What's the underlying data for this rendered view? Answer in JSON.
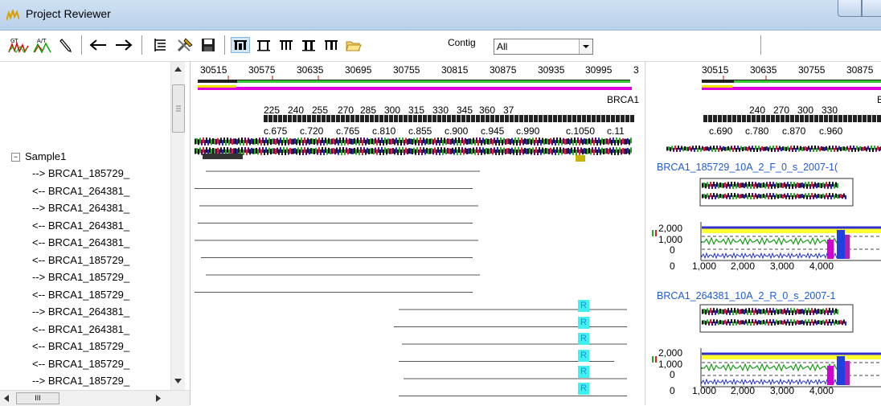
{
  "window": {
    "title": "Project Reviewer"
  },
  "toolbar": {
    "contig_label": "Contig",
    "contig_value": "All"
  },
  "tree": {
    "root": "Sample1",
    "items": [
      "--> BRCA1_185729_",
      "<-- BRCA1_264381_",
      "--> BRCA1_264381_",
      "<-- BRCA1_264381_",
      "<-- BRCA1_264381_",
      "<-- BRCA1_185729_",
      "--> BRCA1_185729_",
      "<-- BRCA1_185729_",
      "--> BRCA1_264381_",
      "<-- BRCA1_264381_",
      "<-- BRCA1_185729_",
      "<-- BRCA1_185729_",
      "--> BRCA1_185729_"
    ]
  },
  "contig": {
    "ruler": [
      "30515",
      "30575",
      "30635",
      "30695",
      "30755",
      "30815",
      "30875",
      "30935",
      "30995",
      "3"
    ],
    "gene_label": "BRCA1",
    "aa_positions": [
      "225",
      "240",
      "255",
      "270",
      "285",
      "300",
      "315",
      "330",
      "345",
      "360",
      "37"
    ],
    "cdna_positions": [
      "c.675",
      "c.720",
      "c.765",
      "c.810",
      "c.855",
      "c.900",
      "c.945",
      "c.990",
      "c.1050",
      "c.11"
    ],
    "r_flag": "R"
  },
  "right": {
    "ruler": [
      "30515",
      "30635",
      "30755",
      "30875"
    ],
    "gene_label": "B",
    "aa_positions": [
      "240",
      "270",
      "300",
      "330"
    ],
    "cdna_positions": [
      "c.690",
      "c.780",
      "c.870",
      "c.960"
    ],
    "trace1_title": "BRCA1_185729_10A_2_F_0_s_2007-1(",
    "trace2_title": "BRCA1_264381_10A_2_R_0_s_2007-1",
    "axis_y": [
      "2,000",
      "1,000",
      "0"
    ],
    "axis_x": [
      "0",
      "1,000",
      "2,000",
      "3,000",
      "4,000"
    ],
    "mini_axis": [
      "0",
      "1,000",
      "2,000",
      "3,000",
      "4,000"
    ]
  }
}
